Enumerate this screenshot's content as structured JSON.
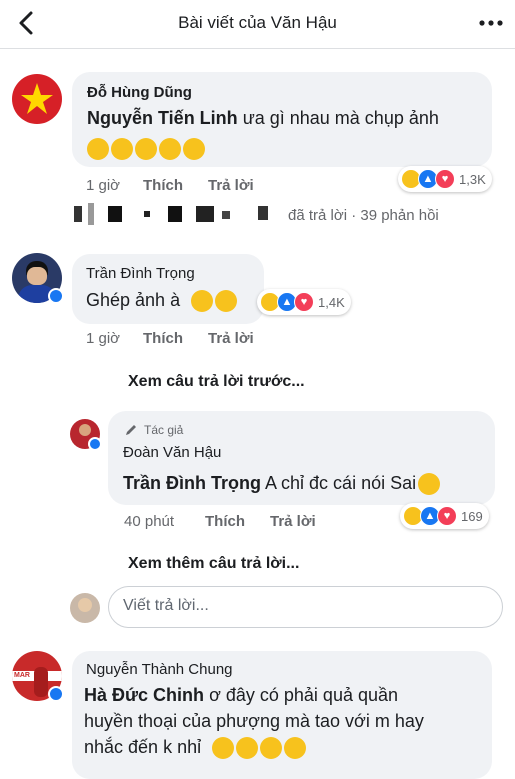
{
  "header": {
    "title": "Bài viết của Văn Hậu"
  },
  "comments": [
    {
      "author": "Đỗ Hùng Dũng",
      "mention": "Nguyễn Tiến Linh",
      "text": "ưa gì nhau mà chụp ảnh",
      "time": "1 giờ",
      "like": "Thích",
      "reply": "Trả lời",
      "reaction_count": "1,3K",
      "reply_summary": "đã trả lời · 39 phản hồi"
    },
    {
      "author": "Trần Đình Trọng",
      "text": "Ghép ảnh à",
      "time": "1 giờ",
      "like": "Thích",
      "reply": "Trả lời",
      "reaction_count": "1,4K"
    }
  ],
  "view_previous": "Xem câu trả lời trước...",
  "reply_comment": {
    "badge": "Tác giả",
    "author": "Đoàn Văn Hậu",
    "mention": "Trần Đình Trọng",
    "text": "A chỉ đc cái nói Sai",
    "time": "40 phút",
    "like": "Thích",
    "reply": "Trả lời",
    "reaction_count": "169"
  },
  "view_more": "Xem thêm câu trả lời...",
  "reply_input": {
    "placeholder": "Viết trả lời..."
  },
  "last_comment": {
    "author": "Nguyễn Thành Chung",
    "mention": "Hà Đức Chinh",
    "line1": "ơ đây có phải quả quần",
    "line2": "huyền thoại của phượng mà tao với m hay",
    "line3": "nhắc đến k nhỉ"
  },
  "colors": {
    "like_blue": "#1877f2",
    "love_red": "#f33e58",
    "haha_yellow": "#f7c21d",
    "bubble": "#f0f2f5"
  }
}
